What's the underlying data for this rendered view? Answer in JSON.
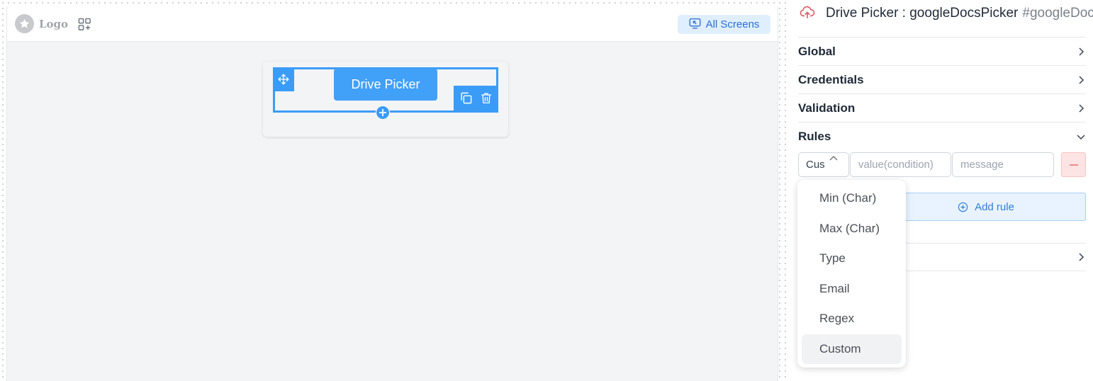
{
  "canvas": {
    "logo_text": "Logo",
    "all_screens_label": "All Screens",
    "widget_label": "Drive Picker"
  },
  "panel": {
    "title": "Drive Picker : googleDocsPicker",
    "hash": "#googleDocsPicker",
    "sections": [
      {
        "label": "Global",
        "state": "collapsed"
      },
      {
        "label": "Credentials",
        "state": "collapsed"
      },
      {
        "label": "Validation",
        "state": "collapsed"
      },
      {
        "label": "Rules",
        "state": "expanded"
      }
    ],
    "rule": {
      "selected_type": "Custom",
      "value_placeholder": "value(condition)",
      "message_placeholder": "message"
    },
    "add_rule_label": "Add rule",
    "dropdown_options": [
      {
        "label": "Min (Char)",
        "selected": false
      },
      {
        "label": "Max (Char)",
        "selected": false
      },
      {
        "label": "Type",
        "selected": false
      },
      {
        "label": "Email",
        "selected": false
      },
      {
        "label": "Regex",
        "selected": false
      },
      {
        "label": "Custom",
        "selected": true
      }
    ]
  },
  "colors": {
    "accent": "#3b9cf7",
    "all_screens_bg": "#e0efff",
    "all_screens_text": "#2b6ed3",
    "cloud_icon": "#e0535f",
    "remove_bg": "#fde4e4"
  },
  "icons": {
    "logo": "star-icon",
    "add_widget": "add-widget-icon",
    "screens": "screen-icon",
    "move": "move-icon",
    "copy": "copy-icon",
    "delete": "trash-icon",
    "add": "plus-icon",
    "panel_header": "cloud-upload-icon"
  }
}
